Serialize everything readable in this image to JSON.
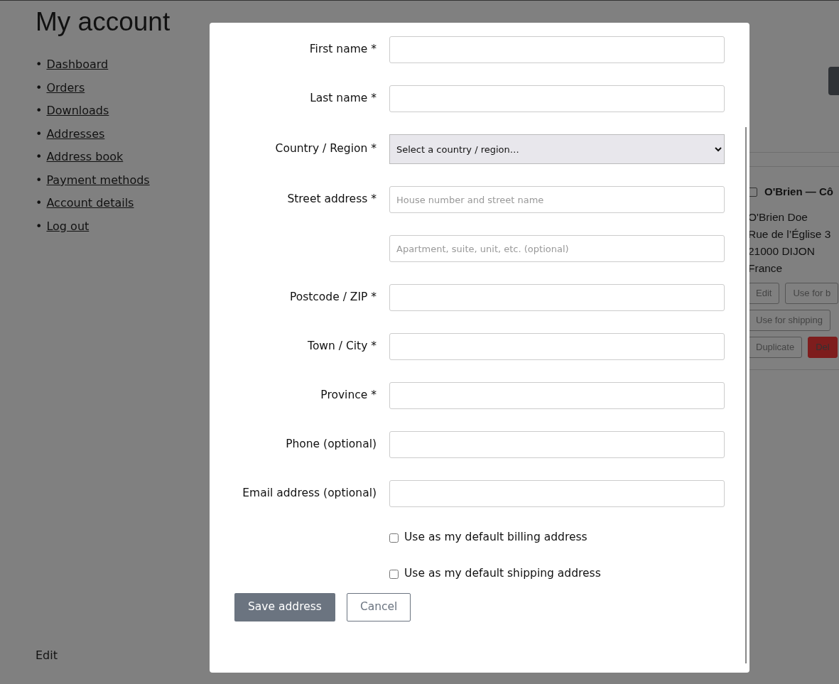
{
  "page": {
    "title": "My account",
    "nav": [
      {
        "bullet": "•",
        "label": "Dashboard"
      },
      {
        "bullet": "•",
        "label": "Orders"
      },
      {
        "bullet": "•",
        "label": "Downloads"
      },
      {
        "bullet": "•",
        "label": "Addresses"
      },
      {
        "bullet": "•",
        "label": "Address book"
      },
      {
        "bullet": "•",
        "label": "Payment methods"
      },
      {
        "bullet": "•",
        "label": "Account details"
      },
      {
        "bullet": "•",
        "label": "Log out"
      }
    ],
    "footer_link": "Edit"
  },
  "address_card": {
    "checked": false,
    "title": "O'Brien — Cô",
    "lines": [
      "O'Brien Doe",
      "Rue de l’Église 3",
      "21000 DIJON",
      "France"
    ],
    "actions": [
      [
        {
          "label": "Edit",
          "kind": "outline"
        },
        {
          "label": "Use for b",
          "kind": "outline"
        }
      ],
      [
        {
          "label": "Use for shipping",
          "kind": "outline"
        }
      ],
      [
        {
          "label": "Duplicate",
          "kind": "outline"
        },
        {
          "label": "Del",
          "kind": "danger"
        }
      ]
    ]
  },
  "modal": {
    "fields": [
      {
        "label": "First name *",
        "kind": "text"
      },
      {
        "label": "Last name *",
        "kind": "text"
      },
      {
        "label": "Country / Region *",
        "kind": "select",
        "value": "Select a country / region…"
      },
      {
        "label": "Street address *",
        "kind": "text",
        "placeholder": "House number and street name"
      },
      {
        "kind": "text",
        "placeholder": "Apartment, suite, unit, etc. (optional)"
      },
      {
        "label": "Postcode / ZIP *",
        "kind": "text"
      },
      {
        "label": "Town / City *",
        "kind": "text"
      },
      {
        "label": "Province *",
        "kind": "text"
      },
      {
        "label": "Phone (optional)",
        "kind": "text"
      },
      {
        "label": "Email address (optional)",
        "kind": "text"
      }
    ],
    "checkboxes": [
      {
        "label": "Use as my default billing address",
        "checked": false
      },
      {
        "label": "Use as my default shipping address",
        "checked": false
      }
    ],
    "buttons": [
      {
        "label": "Save address",
        "kind": "primary"
      },
      {
        "label": "Cancel",
        "kind": "outline"
      }
    ]
  }
}
